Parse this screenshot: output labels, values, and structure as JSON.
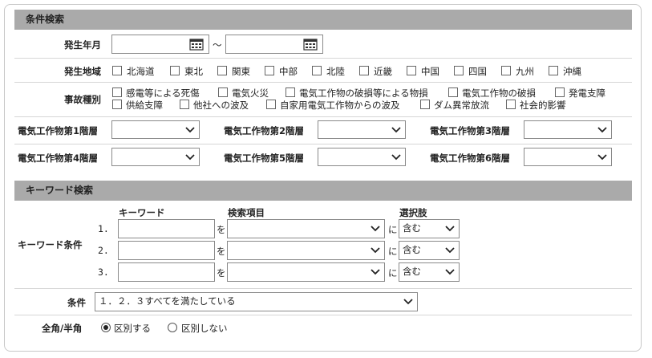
{
  "conditions": {
    "header": "条件検索",
    "date_label": "発生年月",
    "date_sep": "～",
    "date_from": "",
    "date_to": "",
    "region_label": "発生地域",
    "regions": [
      "北海道",
      "東北",
      "関東",
      "中部",
      "北陸",
      "近畿",
      "中国",
      "四国",
      "九州",
      "沖縄"
    ],
    "accident_label": "事故種別",
    "accidents_row1": [
      "感電等による死傷",
      "電気火災",
      "電気工作物の破損等による物損",
      "電気工作物の破損",
      "発電支障"
    ],
    "accidents_row2": [
      "供給支障",
      "他社への波及",
      "自家用電気工作物からの波及",
      "ダム異常放流",
      "社会的影響"
    ],
    "facility": [
      {
        "label": "電気工作物第1階層",
        "value": ""
      },
      {
        "label": "電気工作物第2階層",
        "value": ""
      },
      {
        "label": "電気工作物第3階層",
        "value": ""
      },
      {
        "label": "電気工作物第4階層",
        "value": ""
      },
      {
        "label": "電気工作物第5階層",
        "value": ""
      },
      {
        "label": "電気工作物第6階層",
        "value": ""
      }
    ]
  },
  "keyword": {
    "header": "キーワード検索",
    "col_keyword": "キーワード",
    "col_field": "検索項目",
    "col_choice": "選択肢",
    "row_label": "キーワード条件",
    "particle_wo": "を",
    "particle_ni": "に",
    "rows": [
      {
        "num": "1.",
        "keyword": "",
        "field": "",
        "choice": "含む"
      },
      {
        "num": "2.",
        "keyword": "",
        "field": "",
        "choice": "含む"
      },
      {
        "num": "3.",
        "keyword": "",
        "field": "",
        "choice": "含む"
      }
    ],
    "condition_label": "条件",
    "condition_value": "１．２．３すべてを満たしている",
    "width_label": "全角/半角",
    "width_options": [
      "区別する",
      "区別しない"
    ],
    "width_selected": "区別する"
  }
}
